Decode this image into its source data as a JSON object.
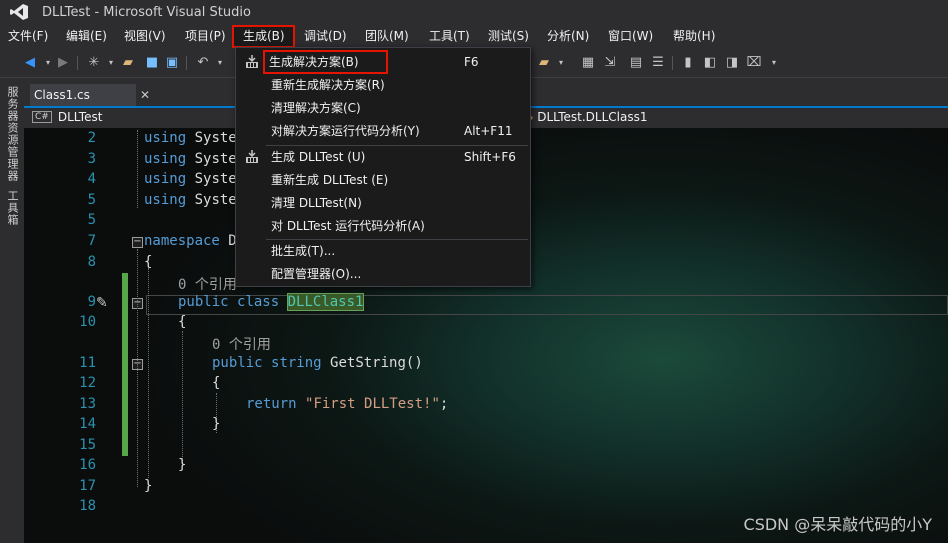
{
  "window": {
    "title": "DLLTest - Microsoft Visual Studio",
    "logo_icon": "vs-logo-icon"
  },
  "menu": [
    {
      "label": "文件(F)"
    },
    {
      "label": "编辑(E)"
    },
    {
      "label": "视图(V)"
    },
    {
      "label": "项目(P)"
    },
    {
      "label": "生成(B)"
    },
    {
      "label": "调试(D)"
    },
    {
      "label": "团队(M)"
    },
    {
      "label": "工具(T)"
    },
    {
      "label": "测试(S)"
    },
    {
      "label": "分析(N)"
    },
    {
      "label": "窗口(W)"
    },
    {
      "label": "帮助(H)"
    }
  ],
  "menu_active": "生成(B)",
  "side_tabs": {
    "server_explorer": "服务器资源管理器",
    "toolbox": "工具箱"
  },
  "doc_tab": {
    "title": "Class1.cs",
    "close_glyph": "✕"
  },
  "navbar": {
    "project_badge": "C#",
    "project": "DLLTest",
    "class": "DLLTest.DLLClass1"
  },
  "build_menu": {
    "items": [
      {
        "label": "生成解决方案(B)",
        "shortcut": "F6",
        "icon": "build-icon"
      },
      {
        "label": "重新生成解决方案(R)",
        "shortcut": ""
      },
      {
        "label": "清理解决方案(C)",
        "shortcut": ""
      },
      {
        "label": "对解决方案运行代码分析(Y)",
        "shortcut": "Alt+F11"
      },
      {
        "label": "生成 DLLTest (U)",
        "shortcut": "Shift+F6",
        "icon": "build-icon"
      },
      {
        "label": "重新生成 DLLTest (E)",
        "shortcut": ""
      },
      {
        "label": "清理 DLLTest(N)",
        "shortcut": ""
      },
      {
        "label": "对 DLLTest 运行代码分析(A)",
        "shortcut": ""
      },
      {
        "label": "批生成(T)...",
        "shortcut": ""
      },
      {
        "label": "配置管理器(O)...",
        "shortcut": ""
      }
    ]
  },
  "code": {
    "line_numbers": [
      "2",
      "3",
      "4",
      "5",
      "7",
      "8",
      "9",
      "10",
      "11",
      "12",
      "13",
      "14",
      "15",
      "16",
      "17",
      "18"
    ],
    "using_kw": "using",
    "using_partial": "Syste",
    "namespace_kw": "namespace",
    "namespace_partial": "D",
    "brace_open": "{",
    "brace_close": "}",
    "ref_count_1": "0 个引用",
    "ref_count_1_partial": "0 个引用",
    "public_kw": "public",
    "class_kw": "class",
    "class_name": "DLLClass1",
    "ref_count_2": "0 个引用",
    "string_kw": "string",
    "method_name": "GetString()",
    "return_kw": "return",
    "return_value": "\"First DLLTest!\"",
    "semicolon": ";"
  },
  "watermark": "CSDN @呆呆敲代码的小Y"
}
